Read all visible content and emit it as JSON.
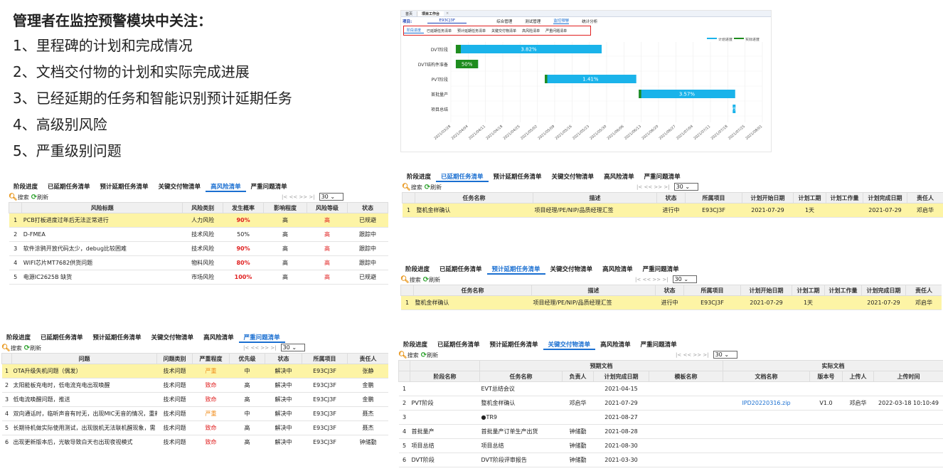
{
  "intro": {
    "heading": "管理者在监控预警模块中关注：",
    "items": [
      "1、里程碑的计划和完成情况",
      "2、文档交付物的计划和实际完成进展",
      "3、已经延期的任务和智能识别预计延期任务",
      "4、高级别风险",
      "5、严重级别问题"
    ]
  },
  "tabs": [
    "阶段进度",
    "已延期任务清单",
    "预计延期任务清单",
    "关键交付物清单",
    "高风险清单",
    "严重问题清单"
  ],
  "toolbar": {
    "search": "搜索",
    "refresh": "刷新",
    "page_size": "30",
    "pager_symbols": "|<  <<   >>  >|"
  },
  "gantt": {
    "top_tab_home": "首页",
    "top_tab_workbench": "项目工作台",
    "project_label": "项目:",
    "project_value": "E93CJ3F",
    "nav": [
      "综合管理",
      "测试管理",
      "监控预警",
      "统计分析"
    ],
    "active_nav": "监控预警",
    "subtabs": [
      "阶段进度",
      "已延期任务清单",
      "预计延期任务清单",
      "关键交付物清单",
      "高风险清单",
      "严重问题清单"
    ],
    "legend": [
      "计划进度",
      "实际进度"
    ],
    "colors": {
      "plan": "#1ab3ea",
      "actual": "#1e8c1e",
      "frame": "#e02020"
    }
  },
  "chart_data": {
    "type": "gantt",
    "categories": [
      "DVT阶段",
      "DVT结构件准备",
      "PVT阶段",
      "首批量产",
      "项目总结"
    ],
    "x_ticks": [
      "2021/03/28",
      "2021/04/04",
      "2021/04/11",
      "2021/04/18",
      "2021/04/25",
      "2021/05/02",
      "2021/05/09",
      "2021/05/16",
      "2021/05/23",
      "2021/05/30",
      "2021/06/06",
      "2021/06/13",
      "2021/06/20",
      "2021/06/27",
      "2021/07/04",
      "2021/07/11",
      "2021/07/18",
      "2021/07/25",
      "2021/08/01"
    ],
    "series": [
      {
        "name": "计划进度",
        "tasks": [
          {
            "category": "DVT阶段",
            "start": "2021-03-30",
            "end": "2021-05-28",
            "label": "3.82%"
          },
          {
            "category": "DVT结构件准备",
            "start": "2021-03-30",
            "end": "2021-04-08",
            "label": "50%"
          },
          {
            "category": "PVT阶段",
            "start": "2021-05-05",
            "end": "2021-06-11",
            "label": "1.41%"
          },
          {
            "category": "首批量产",
            "start": "2021-06-12",
            "end": "2021-07-21",
            "label": "3.57%"
          },
          {
            "category": "项目总结",
            "start": "2021-07-20",
            "end": "2021-07-21",
            "label": "0%"
          }
        ]
      },
      {
        "name": "实际进度",
        "tasks": [
          {
            "category": "DVT阶段",
            "start": "2021-03-30",
            "end": "2021-04-01"
          },
          {
            "category": "DVT结构件准备",
            "start": "2021-03-30",
            "end": "2021-04-08"
          },
          {
            "category": "PVT阶段",
            "start": "2021-05-05",
            "end": "2021-05-06"
          },
          {
            "category": "首批量产",
            "start": "2021-06-12",
            "end": "2021-06-13"
          }
        ]
      }
    ]
  },
  "risk": {
    "active_tab": "高风险清单",
    "headers": [
      "",
      "风险标题",
      "风险类别",
      "发生概率",
      "影响程度",
      "风险等级",
      "状态"
    ],
    "rows": [
      [
        "1",
        "PCB打板进度过年后无法正常进行",
        "人力风险",
        "90%",
        "高",
        "高",
        "已规避"
      ],
      [
        "2",
        "D-FMEA",
        "技术风险",
        "50%",
        "高",
        "高",
        "跟踪中"
      ],
      [
        "3",
        "软件涂鸦开放代码太少，debug比较困难",
        "技术风险",
        "90%",
        "高",
        "高",
        "跟踪中"
      ],
      [
        "4",
        "WIFI芯片MT7682供货问题",
        "物料风险",
        "80%",
        "高",
        "高",
        "跟踪中"
      ],
      [
        "5",
        "电源IC2625B 缺货",
        "市场风险",
        "100%",
        "高",
        "高",
        "已规避"
      ]
    ]
  },
  "delayed": {
    "active_tab": "已延期任务清单",
    "headers": [
      "",
      "任务名称",
      "描述",
      "状态",
      "所属项目",
      "计划开始日期",
      "计划工期",
      "计划工作量",
      "计划完成日期",
      "责任人"
    ],
    "rows": [
      [
        "1",
        "整机金样确认",
        "项目经理/PE/NIP/品质经理汇签",
        "进行中",
        "E93CJ3F",
        "2021-07-29",
        "1天",
        "",
        "2021-07-29",
        "邓启华"
      ]
    ]
  },
  "expected": {
    "active_tab": "预计延期任务清单",
    "headers": [
      "",
      "任务名称",
      "描述",
      "状态",
      "所属项目",
      "计划开始日期",
      "计划工期",
      "计划工作量",
      "计划完成日期",
      "责任人"
    ],
    "rows": [
      [
        "1",
        "整机金样确认",
        "项目经理/PE/NIP/品质经理汇签",
        "进行中",
        "E93CJ3F",
        "2021-07-29",
        "1天",
        "",
        "2021-07-29",
        "邓启华"
      ]
    ]
  },
  "issues": {
    "active_tab": "严重问题清单",
    "headers": [
      "",
      "问题",
      "问题类别",
      "严重程度",
      "优先级",
      "状态",
      "所属项目",
      "责任人"
    ],
    "rows": [
      [
        "1",
        "OTA升级失机问题（偶发）",
        "技术问题",
        "严重",
        "中",
        "解决中",
        "E93CJ3F",
        "张静"
      ],
      [
        "2",
        "太阳能板充电时，低电流充电出现唤醒",
        "技术问题",
        "致命",
        "高",
        "解决中",
        "E93CJ3F",
        "金鹏"
      ],
      [
        "3",
        "低电流唤醒问题，推送",
        "技术问题",
        "致命",
        "高",
        "解决中",
        "E93CJ3F",
        "金鹏"
      ],
      [
        "4",
        "双向通话时，临听声音有时无，出现MIC无音的情况，重新",
        "技术问题",
        "严重",
        "中",
        "解决中",
        "E93CJ3F",
        "聂杰"
      ],
      [
        "5",
        "长期待机做实际使用测试，出现脱机无法联机醒现象，需",
        "技术问题",
        "致命",
        "高",
        "解决中",
        "E93CJ3F",
        "聂杰"
      ],
      [
        "6",
        "出现更新版本后，光敏导致白天也出现夜视模式",
        "技术问题",
        "致命",
        "高",
        "解决中",
        "E93CJ3F",
        "钟储勤"
      ],
      [
        "7",
        "软件客户的问题涂鸦一直没有更新版本，标掉了20天",
        "技术问题",
        "严重",
        "高",
        "解决中",
        "E93CJ3F",
        "钟储勤"
      ]
    ]
  },
  "deliver": {
    "active_tab": "关键交付物清单",
    "group_plan": "预期文档",
    "group_actual": "实际文档",
    "headers": [
      "",
      "阶段名称",
      "任务名称",
      "负责人",
      "计划完成日期",
      "模板名称",
      "文档名称",
      "版本号",
      "上传人",
      "上传时间"
    ],
    "rows": [
      [
        "1",
        "",
        "EVT总结会议",
        "",
        "2021-04-15",
        "",
        "",
        "",
        "",
        ""
      ],
      [
        "2",
        "PVT阶段",
        "整机金样确认",
        "邓启华",
        "2021-07-29",
        "",
        "IPD20220316.zip",
        "V1.0",
        "邓启华",
        "2022-03-18 10:10:49"
      ],
      [
        "3",
        "",
        "●TR9",
        "",
        "2021-08-27",
        "",
        "",
        "",
        "",
        ""
      ],
      [
        "4",
        "首批量产",
        "首批量产订单生产出货",
        "钟储勤",
        "2021-08-28",
        "",
        "",
        "",
        "",
        ""
      ],
      [
        "5",
        "项目总结",
        "项目总结",
        "钟储勤",
        "2021-08-30",
        "",
        "",
        "",
        "",
        ""
      ],
      [
        "6",
        "DVT阶段",
        "DVT阶段评审报告",
        "钟储勤",
        "2021-03-30",
        "",
        "",
        "",
        "",
        ""
      ],
      [
        "7",
        "",
        "DVT阶段评审",
        "钟储勤",
        "2021-03-30",
        "",
        "",
        "",
        "",
        ""
      ]
    ]
  }
}
